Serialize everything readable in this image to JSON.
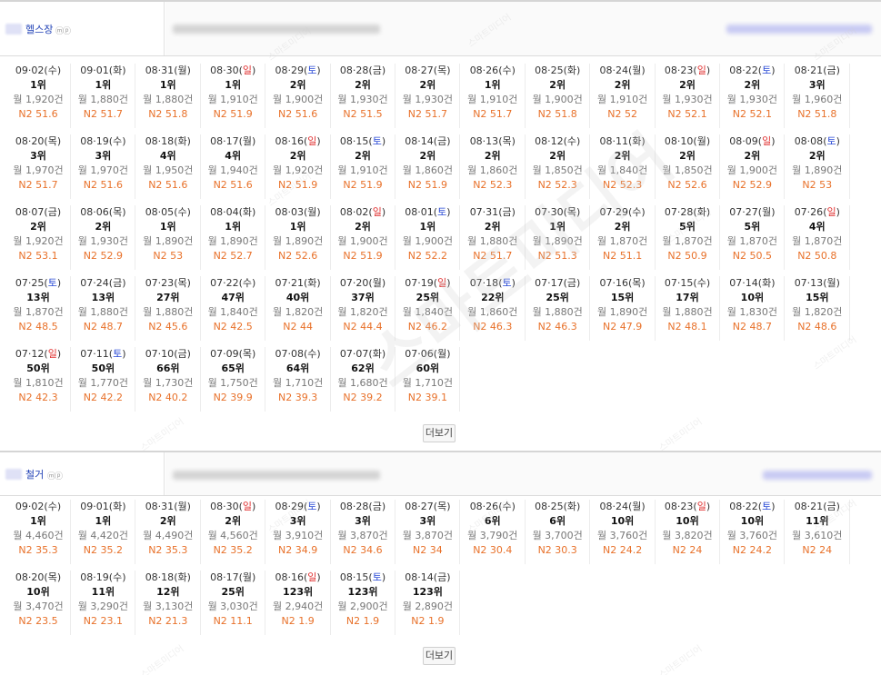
{
  "watermark": "스마트미디어",
  "sections": [
    {
      "keyword": "헬스장",
      "badges": "ⓜⓟ",
      "more_label": "더보기",
      "cells": [
        {
          "day": "09·02",
          "dow": "수",
          "rank": "1위",
          "vol": "월 1,920건",
          "n2": "N2 51.6"
        },
        {
          "day": "09·01",
          "dow": "화",
          "rank": "1위",
          "vol": "월 1,880건",
          "n2": "N2 51.7"
        },
        {
          "day": "08·31",
          "dow": "월",
          "rank": "1위",
          "vol": "월 1,880건",
          "n2": "N2 51.8"
        },
        {
          "day": "08·30",
          "dow": "일",
          "rank": "1위",
          "vol": "월 1,910건",
          "n2": "N2 51.9"
        },
        {
          "day": "08·29",
          "dow": "토",
          "rank": "2위",
          "vol": "월 1,900건",
          "n2": "N2 51.6"
        },
        {
          "day": "08·28",
          "dow": "금",
          "rank": "2위",
          "vol": "월 1,930건",
          "n2": "N2 51.5"
        },
        {
          "day": "08·27",
          "dow": "목",
          "rank": "2위",
          "vol": "월 1,930건",
          "n2": "N2 51.7"
        },
        {
          "day": "08·26",
          "dow": "수",
          "rank": "1위",
          "vol": "월 1,910건",
          "n2": "N2 51.7"
        },
        {
          "day": "08·25",
          "dow": "화",
          "rank": "2위",
          "vol": "월 1,900건",
          "n2": "N2 51.8"
        },
        {
          "day": "08·24",
          "dow": "월",
          "rank": "2위",
          "vol": "월 1,910건",
          "n2": "N2 52"
        },
        {
          "day": "08·23",
          "dow": "일",
          "rank": "2위",
          "vol": "월 1,930건",
          "n2": "N2 52.1"
        },
        {
          "day": "08·22",
          "dow": "토",
          "rank": "2위",
          "vol": "월 1,930건",
          "n2": "N2 52.1"
        },
        {
          "day": "08·21",
          "dow": "금",
          "rank": "3위",
          "vol": "월 1,960건",
          "n2": "N2 51.8"
        },
        {
          "day": "08·20",
          "dow": "목",
          "rank": "3위",
          "vol": "월 1,970건",
          "n2": "N2 51.7"
        },
        {
          "day": "08·19",
          "dow": "수",
          "rank": "3위",
          "vol": "월 1,970건",
          "n2": "N2 51.6"
        },
        {
          "day": "08·18",
          "dow": "화",
          "rank": "4위",
          "vol": "월 1,950건",
          "n2": "N2 51.6"
        },
        {
          "day": "08·17",
          "dow": "월",
          "rank": "4위",
          "vol": "월 1,940건",
          "n2": "N2 51.6"
        },
        {
          "day": "08·16",
          "dow": "일",
          "rank": "2위",
          "vol": "월 1,920건",
          "n2": "N2 51.9"
        },
        {
          "day": "08·15",
          "dow": "토",
          "rank": "2위",
          "vol": "월 1,910건",
          "n2": "N2 51.9"
        },
        {
          "day": "08·14",
          "dow": "금",
          "rank": "2위",
          "vol": "월 1,860건",
          "n2": "N2 51.9"
        },
        {
          "day": "08·13",
          "dow": "목",
          "rank": "2위",
          "vol": "월 1,860건",
          "n2": "N2 52.3"
        },
        {
          "day": "08·12",
          "dow": "수",
          "rank": "2위",
          "vol": "월 1,850건",
          "n2": "N2 52.3"
        },
        {
          "day": "08·11",
          "dow": "화",
          "rank": "2위",
          "vol": "월 1,840건",
          "n2": "N2 52.3"
        },
        {
          "day": "08·10",
          "dow": "월",
          "rank": "2위",
          "vol": "월 1,850건",
          "n2": "N2 52.6"
        },
        {
          "day": "08·09",
          "dow": "일",
          "rank": "2위",
          "vol": "월 1,900건",
          "n2": "N2 52.9"
        },
        {
          "day": "08·08",
          "dow": "토",
          "rank": "2위",
          "vol": "월 1,890건",
          "n2": "N2 53"
        },
        {
          "day": "08·07",
          "dow": "금",
          "rank": "2위",
          "vol": "월 1,920건",
          "n2": "N2 53.1"
        },
        {
          "day": "08·06",
          "dow": "목",
          "rank": "2위",
          "vol": "월 1,930건",
          "n2": "N2 52.9"
        },
        {
          "day": "08·05",
          "dow": "수",
          "rank": "1위",
          "vol": "월 1,890건",
          "n2": "N2 53"
        },
        {
          "day": "08·04",
          "dow": "화",
          "rank": "1위",
          "vol": "월 1,890건",
          "n2": "N2 52.7"
        },
        {
          "day": "08·03",
          "dow": "월",
          "rank": "1위",
          "vol": "월 1,890건",
          "n2": "N2 52.6"
        },
        {
          "day": "08·02",
          "dow": "일",
          "rank": "2위",
          "vol": "월 1,900건",
          "n2": "N2 51.9"
        },
        {
          "day": "08·01",
          "dow": "토",
          "rank": "1위",
          "vol": "월 1,900건",
          "n2": "N2 52.2"
        },
        {
          "day": "07·31",
          "dow": "금",
          "rank": "2위",
          "vol": "월 1,880건",
          "n2": "N2 51.7"
        },
        {
          "day": "07·30",
          "dow": "목",
          "rank": "1위",
          "vol": "월 1,890건",
          "n2": "N2 51.3"
        },
        {
          "day": "07·29",
          "dow": "수",
          "rank": "2위",
          "vol": "월 1,870건",
          "n2": "N2 51.1"
        },
        {
          "day": "07·28",
          "dow": "화",
          "rank": "5위",
          "vol": "월 1,870건",
          "n2": "N2 50.9"
        },
        {
          "day": "07·27",
          "dow": "월",
          "rank": "5위",
          "vol": "월 1,870건",
          "n2": "N2 50.5"
        },
        {
          "day": "07·26",
          "dow": "일",
          "rank": "4위",
          "vol": "월 1,870건",
          "n2": "N2 50.8"
        },
        {
          "day": "07·25",
          "dow": "토",
          "rank": "13위",
          "vol": "월 1,870건",
          "n2": "N2 48.5"
        },
        {
          "day": "07·24",
          "dow": "금",
          "rank": "13위",
          "vol": "월 1,880건",
          "n2": "N2 48.7"
        },
        {
          "day": "07·23",
          "dow": "목",
          "rank": "27위",
          "vol": "월 1,880건",
          "n2": "N2 45.6"
        },
        {
          "day": "07·22",
          "dow": "수",
          "rank": "47위",
          "vol": "월 1,840건",
          "n2": "N2 42.5"
        },
        {
          "day": "07·21",
          "dow": "화",
          "rank": "40위",
          "vol": "월 1,820건",
          "n2": "N2 44"
        },
        {
          "day": "07·20",
          "dow": "월",
          "rank": "37위",
          "vol": "월 1,820건",
          "n2": "N2 44.4"
        },
        {
          "day": "07·19",
          "dow": "일",
          "rank": "25위",
          "vol": "월 1,840건",
          "n2": "N2 46.2"
        },
        {
          "day": "07·18",
          "dow": "토",
          "rank": "22위",
          "vol": "월 1,860건",
          "n2": "N2 46.3"
        },
        {
          "day": "07·17",
          "dow": "금",
          "rank": "25위",
          "vol": "월 1,880건",
          "n2": "N2 46.3"
        },
        {
          "day": "07·16",
          "dow": "목",
          "rank": "15위",
          "vol": "월 1,890건",
          "n2": "N2 47.9"
        },
        {
          "day": "07·15",
          "dow": "수",
          "rank": "17위",
          "vol": "월 1,880건",
          "n2": "N2 48.1"
        },
        {
          "day": "07·14",
          "dow": "화",
          "rank": "10위",
          "vol": "월 1,830건",
          "n2": "N2 48.7"
        },
        {
          "day": "07·13",
          "dow": "월",
          "rank": "15위",
          "vol": "월 1,820건",
          "n2": "N2 48.6"
        },
        {
          "day": "07·12",
          "dow": "일",
          "rank": "50위",
          "vol": "월 1,810건",
          "n2": "N2 42.3"
        },
        {
          "day": "07·11",
          "dow": "토",
          "rank": "50위",
          "vol": "월 1,770건",
          "n2": "N2 42.2"
        },
        {
          "day": "07·10",
          "dow": "금",
          "rank": "66위",
          "vol": "월 1,730건",
          "n2": "N2 40.2"
        },
        {
          "day": "07·09",
          "dow": "목",
          "rank": "65위",
          "vol": "월 1,750건",
          "n2": "N2 39.9"
        },
        {
          "day": "07·08",
          "dow": "수",
          "rank": "64위",
          "vol": "월 1,710건",
          "n2": "N2 39.3"
        },
        {
          "day": "07·07",
          "dow": "화",
          "rank": "62위",
          "vol": "월 1,680건",
          "n2": "N2 39.2"
        },
        {
          "day": "07·06",
          "dow": "월",
          "rank": "60위",
          "vol": "월 1,710건",
          "n2": "N2 39.1"
        }
      ]
    },
    {
      "keyword": "철거",
      "badges": "ⓜⓟ",
      "more_label": "더보기",
      "cells": [
        {
          "day": "09·02",
          "dow": "수",
          "rank": "1위",
          "vol": "월 4,460건",
          "n2": "N2 35.3"
        },
        {
          "day": "09·01",
          "dow": "화",
          "rank": "1위",
          "vol": "월 4,420건",
          "n2": "N2 35.2"
        },
        {
          "day": "08·31",
          "dow": "월",
          "rank": "2위",
          "vol": "월 4,490건",
          "n2": "N2 35.3"
        },
        {
          "day": "08·30",
          "dow": "일",
          "rank": "2위",
          "vol": "월 4,560건",
          "n2": "N2 35.2"
        },
        {
          "day": "08·29",
          "dow": "토",
          "rank": "3위",
          "vol": "월 3,910건",
          "n2": "N2 34.9"
        },
        {
          "day": "08·28",
          "dow": "금",
          "rank": "3위",
          "vol": "월 3,870건",
          "n2": "N2 34.6"
        },
        {
          "day": "08·27",
          "dow": "목",
          "rank": "3위",
          "vol": "월 3,870건",
          "n2": "N2 34"
        },
        {
          "day": "08·26",
          "dow": "수",
          "rank": "6위",
          "vol": "월 3,790건",
          "n2": "N2 30.4"
        },
        {
          "day": "08·25",
          "dow": "화",
          "rank": "6위",
          "vol": "월 3,700건",
          "n2": "N2 30.3"
        },
        {
          "day": "08·24",
          "dow": "월",
          "rank": "10위",
          "vol": "월 3,760건",
          "n2": "N2 24.2"
        },
        {
          "day": "08·23",
          "dow": "일",
          "rank": "10위",
          "vol": "월 3,820건",
          "n2": "N2 24"
        },
        {
          "day": "08·22",
          "dow": "토",
          "rank": "10위",
          "vol": "월 3,760건",
          "n2": "N2 24.2"
        },
        {
          "day": "08·21",
          "dow": "금",
          "rank": "11위",
          "vol": "월 3,610건",
          "n2": "N2 24"
        },
        {
          "day": "08·20",
          "dow": "목",
          "rank": "10위",
          "vol": "월 3,470건",
          "n2": "N2 23.5"
        },
        {
          "day": "08·19",
          "dow": "수",
          "rank": "11위",
          "vol": "월 3,290건",
          "n2": "N2 23.1"
        },
        {
          "day": "08·18",
          "dow": "화",
          "rank": "12위",
          "vol": "월 3,130건",
          "n2": "N2 21.3"
        },
        {
          "day": "08·17",
          "dow": "월",
          "rank": "25위",
          "vol": "월 3,030건",
          "n2": "N2 11.1"
        },
        {
          "day": "08·16",
          "dow": "일",
          "rank": "123위",
          "vol": "월 2,940건",
          "n2": "N2 1.9"
        },
        {
          "day": "08·15",
          "dow": "토",
          "rank": "123위",
          "vol": "월 2,900건",
          "n2": "N2 1.9"
        },
        {
          "day": "08·14",
          "dow": "금",
          "rank": "123위",
          "vol": "월 2,890건",
          "n2": "N2 1.9"
        }
      ]
    }
  ]
}
